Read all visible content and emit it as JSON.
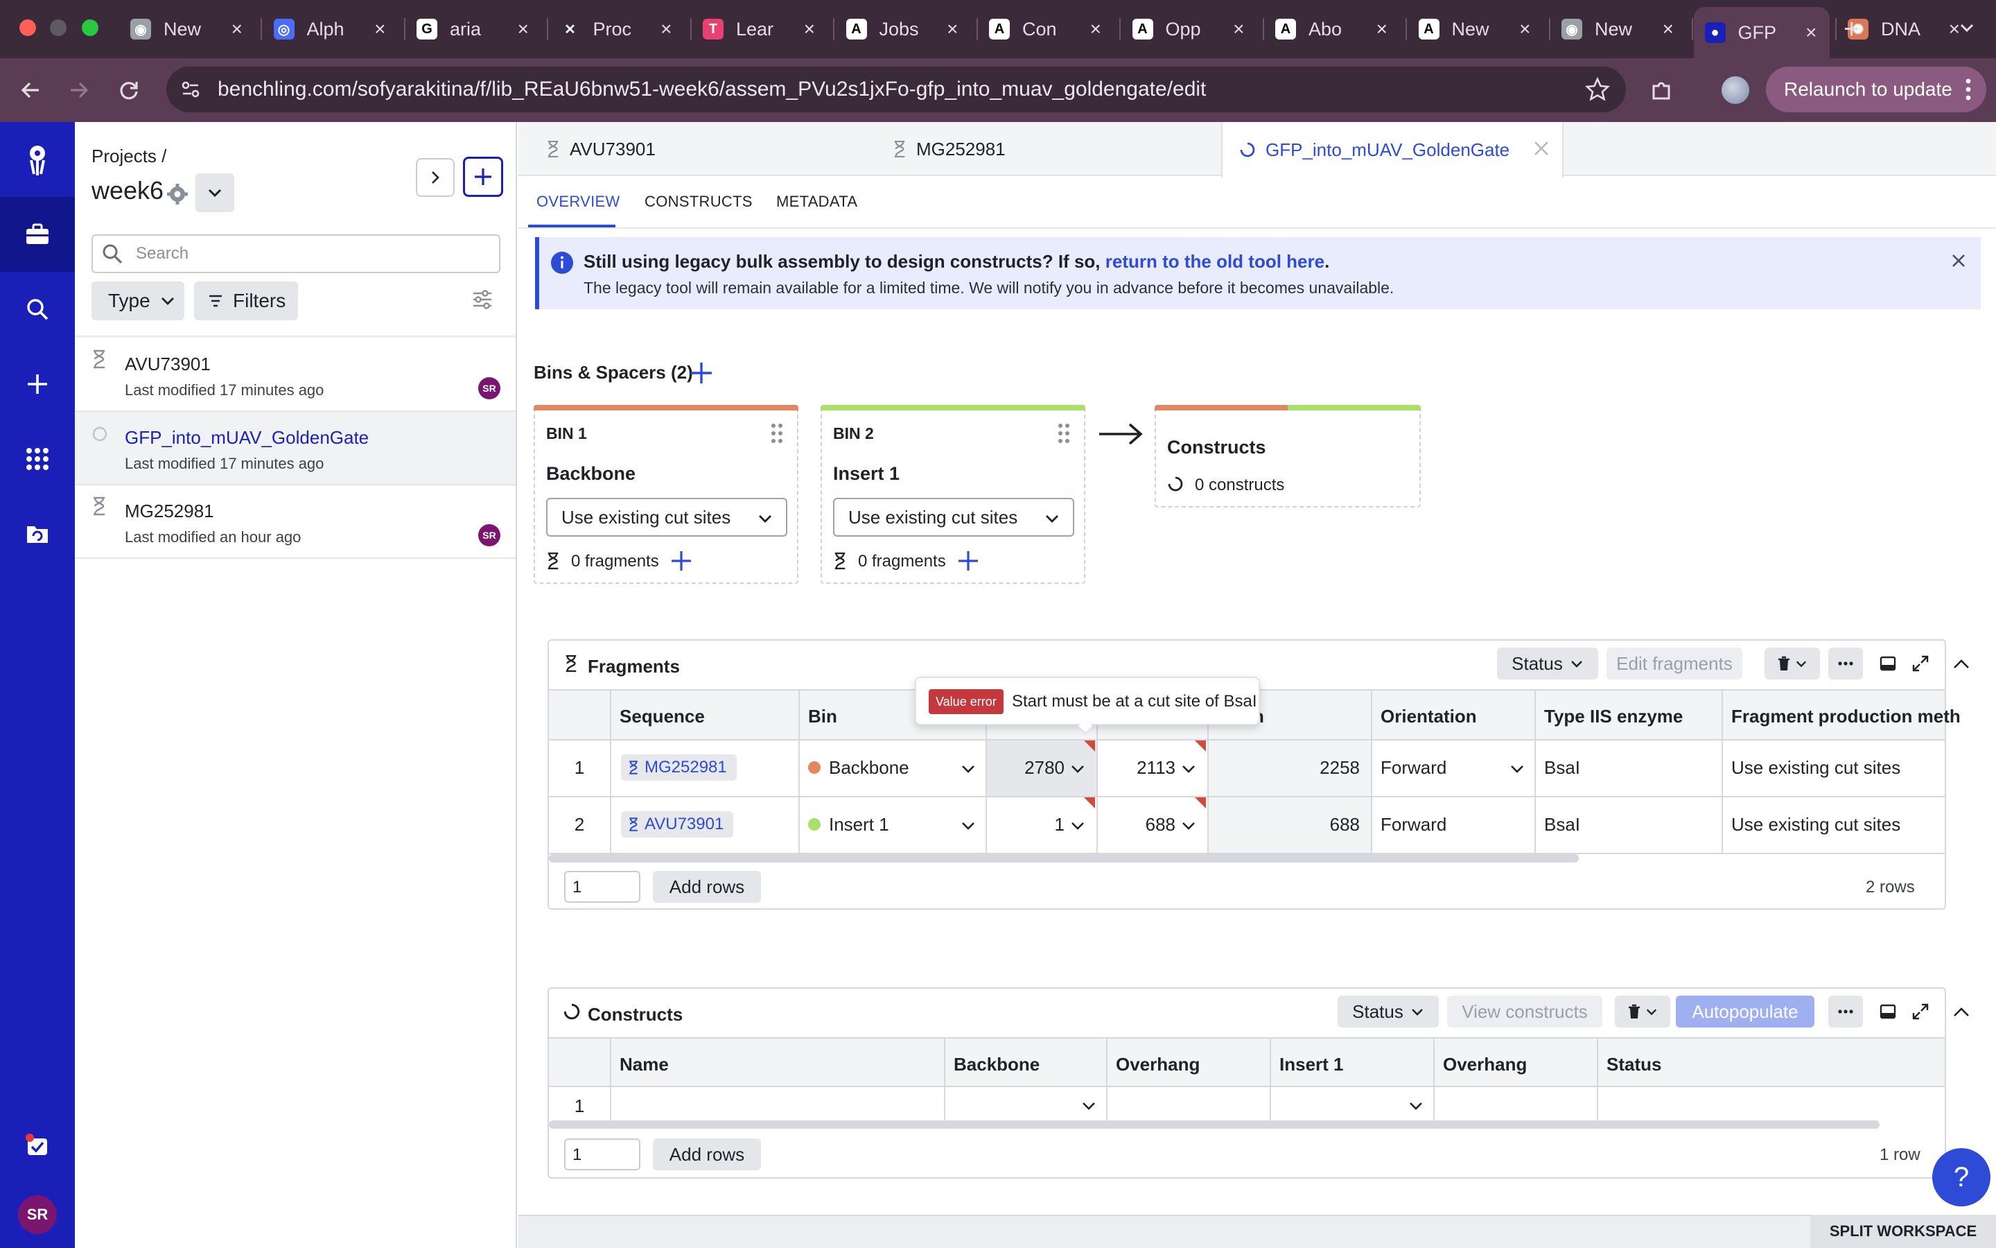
{
  "browser": {
    "tabs": [
      {
        "title": "New",
        "icon": "chrome-icon"
      },
      {
        "title": "Alph",
        "icon": "circle-logo-icon"
      },
      {
        "title": "aria",
        "icon": "google-icon"
      },
      {
        "title": "Proc",
        "icon": "x-logo-icon"
      },
      {
        "title": "Lear",
        "icon": "t-logo-icon"
      },
      {
        "title": "Jobs",
        "icon": "a-logo-icon"
      },
      {
        "title": "Con",
        "icon": "a-logo-icon"
      },
      {
        "title": "Opp",
        "icon": "a-logo-icon"
      },
      {
        "title": "Abo",
        "icon": "a-logo-icon"
      },
      {
        "title": "New",
        "icon": "a-logo-icon"
      },
      {
        "title": "New",
        "icon": "chrome-icon"
      },
      {
        "title": "GFP",
        "icon": "benchling-icon"
      },
      {
        "title": "DNA",
        "icon": "sunburst-icon"
      }
    ],
    "url": "benchling.com/sofyarakitina/f/lib_REaU6bnw51-week6/assem_PVu2s1jxFo-gfp_into_muav_goldengate/edit",
    "relaunch_label": "Relaunch to update"
  },
  "sidebar": {
    "breadcrumb": "Projects /",
    "project_name": "week6",
    "search_placeholder": "Search",
    "type_label": "Type",
    "filters_label": "Filters",
    "items": [
      {
        "name": "AVU73901",
        "modified": "Last modified 17 minutes ago",
        "avatar": "SR",
        "selected": false
      },
      {
        "name": "GFP_into_mUAV_GoldenGate",
        "modified": "Last modified 17 minutes ago",
        "avatar": "",
        "selected": true
      },
      {
        "name": "MG252981",
        "modified": "Last modified an hour ago",
        "avatar": "SR",
        "selected": false
      }
    ]
  },
  "rail": {
    "user_initials": "SR"
  },
  "main": {
    "tabs": [
      "AVU73901",
      "MG252981",
      "GFP_into_mUAV_GoldenGate"
    ],
    "subtabs": [
      "OVERVIEW",
      "CONSTRUCTS",
      "METADATA"
    ],
    "banner": {
      "line1": "Still using legacy bulk assembly to design constructs? If so,",
      "link": "return to the old tool here",
      "period": ".",
      "line2": "The legacy tool will remain available for a limited time. We will notify you in advance before it becomes unavailable."
    },
    "bins_title": "Bins & Spacers (2)",
    "bins": [
      {
        "tag": "BIN 1",
        "name": "Backbone",
        "method": "Use existing cut sites",
        "fragments": "0 fragments",
        "color": "#e2875f"
      },
      {
        "tag": "BIN 2",
        "name": "Insert 1",
        "method": "Use existing cut sites",
        "fragments": "0 fragments",
        "color": "#a8e06a"
      }
    ],
    "constructs_card": {
      "title": "Constructs",
      "count": "0 constructs"
    },
    "fragments": {
      "title": "Fragments",
      "status_label": "Status",
      "edit_label": "Edit fragments",
      "columns": [
        "Sequence",
        "Bin",
        "",
        "",
        "h",
        "Orientation",
        "Type IIS enzyme",
        "Fragment production meth"
      ],
      "rows": [
        {
          "num": "1",
          "sequence": "MG252981",
          "bin": "Backbone",
          "bin_color": "#e2875f",
          "start": "2780",
          "end": "2113",
          "length": "2258",
          "orientation": "Forward",
          "enzyme": "BsaI",
          "method": "Use existing cut sites"
        },
        {
          "num": "2",
          "sequence": "AVU73901",
          "bin": "Insert 1",
          "bin_color": "#a8e06a",
          "start": "1",
          "end": "688",
          "length": "688",
          "orientation": "Forward",
          "enzyme": "BsaI",
          "method": "Use existing cut sites"
        }
      ],
      "add_count": "1",
      "add_label": "Add rows",
      "row_count": "2 rows"
    },
    "tooltip": {
      "badge": "Value error",
      "text": "Start must be at a cut site of BsaI"
    },
    "constructs": {
      "title": "Constructs",
      "status_label": "Status",
      "view_label": "View constructs",
      "autopopulate_label": "Autopopulate",
      "columns": [
        "Name",
        "Backbone",
        "Overhang",
        "Insert 1",
        "Overhang",
        "Status"
      ],
      "rows": [
        {
          "num": "1"
        }
      ],
      "add_count": "1",
      "add_label": "Add rows",
      "row_count": "1 row"
    },
    "split_workspace": "SPLIT WORKSPACE",
    "help": "?"
  }
}
